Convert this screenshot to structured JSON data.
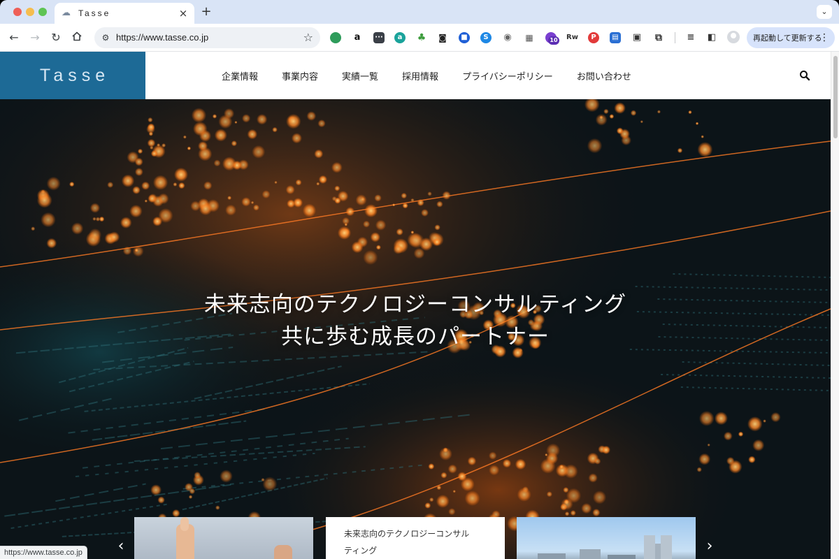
{
  "browser": {
    "tab_title": "Tasse",
    "tab_close": "×",
    "new_tab": "+",
    "url": "https://www.tasse.co.jp",
    "update_button": "再起動して更新する",
    "extension_badge": "10",
    "status_url": "https://www.tasse.co.jp"
  },
  "site": {
    "logo": "Tasse",
    "nav": [
      "企業情報",
      "事業内容",
      "実績一覧",
      "採用情報",
      "プライバシーポリシー",
      "お問い合わせ"
    ],
    "accent_color": "#1d6a96"
  },
  "hero": {
    "line1": "未来志向のテクノロジーコンサルティング",
    "line2": "共に歩む成長のパートナー"
  },
  "cards": [
    {
      "text": ""
    },
    {
      "text": "未来志向のテクノロジーコンサル",
      "text2": "ティング"
    },
    {
      "text": ""
    }
  ],
  "carousel": {
    "prev": "‹",
    "next": "›"
  }
}
